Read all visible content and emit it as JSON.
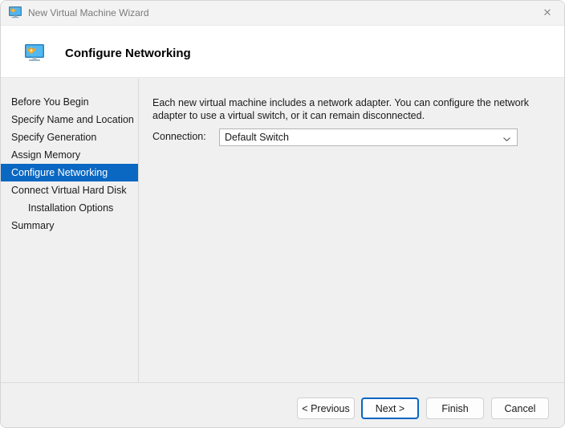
{
  "window": {
    "title": "New Virtual Machine Wizard",
    "title_icon": "virtual-machine-monitor-icon",
    "close_label": "✕"
  },
  "header": {
    "icon": "network-monitor-icon",
    "title": "Configure Networking"
  },
  "sidebar": {
    "items": [
      {
        "label": "Before You Begin",
        "selected": false,
        "indent": false
      },
      {
        "label": "Specify Name and Location",
        "selected": false,
        "indent": false
      },
      {
        "label": "Specify Generation",
        "selected": false,
        "indent": false
      },
      {
        "label": "Assign Memory",
        "selected": false,
        "indent": false
      },
      {
        "label": "Configure Networking",
        "selected": true,
        "indent": false
      },
      {
        "label": "Connect Virtual Hard Disk",
        "selected": false,
        "indent": false
      },
      {
        "label": "Installation Options",
        "selected": false,
        "indent": true
      },
      {
        "label": "Summary",
        "selected": false,
        "indent": false
      }
    ]
  },
  "main": {
    "description": "Each new virtual machine includes a network adapter. You can configure the network adapter to use a virtual switch, or it can remain disconnected.",
    "connection_label": "Connection:",
    "connection_value": "Default Switch",
    "connection_options": [
      "Default Switch"
    ]
  },
  "footer": {
    "previous_label": "< Previous",
    "next_label": "Next >",
    "finish_label": "Finish",
    "cancel_label": "Cancel"
  },
  "colors": {
    "selection_blue": "#0a67c2",
    "focus_blue": "#0a67c2",
    "window_background": "#f0f0f0",
    "header_background": "#ffffff",
    "titlebar_background": "#f3f3f3"
  }
}
